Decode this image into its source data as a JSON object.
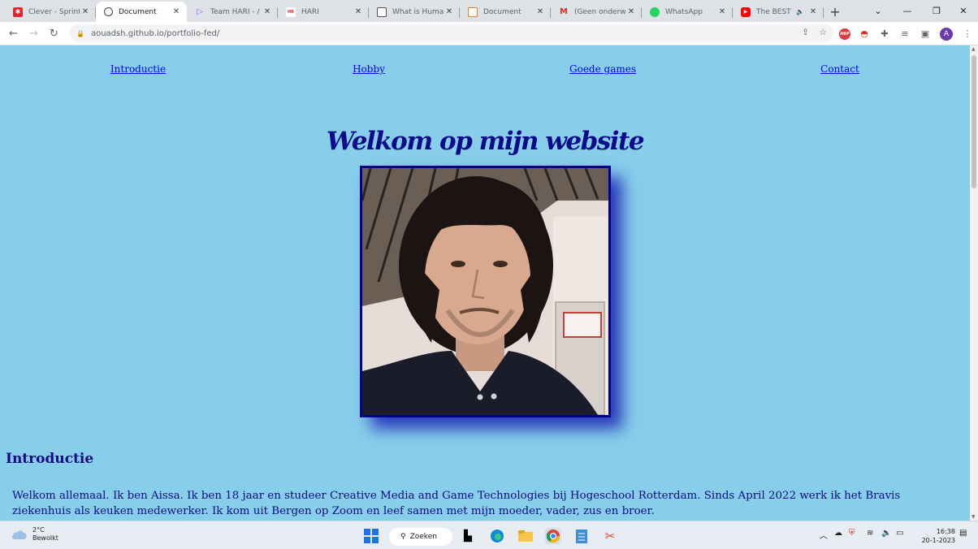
{
  "browser": {
    "tabs": [
      {
        "title": "Clever - Sprint",
        "favicon": "#e0282f"
      },
      {
        "title": "Document",
        "favicon": "#444444",
        "active": true
      },
      {
        "title": "Team HARI - /",
        "favicon": "#a05cf0"
      },
      {
        "title": "HARI",
        "favicon": "#e0282f"
      },
      {
        "title": "What is Huma",
        "favicon": "#555555"
      },
      {
        "title": "Document",
        "favicon": "#f07c1a"
      },
      {
        "title": "(Geen onderw",
        "favicon": "#d93025"
      },
      {
        "title": "WhatsApp",
        "favicon": "#25d366"
      },
      {
        "title": "The BEST",
        "favicon": "#ff0000"
      }
    ],
    "url": "aouadsh.github.io/portfolio-fed/",
    "profile_initial": "A"
  },
  "page": {
    "nav": [
      "Introductie",
      "Hobby",
      "Goede games",
      "Contact"
    ],
    "title": "Welkom op mijn website",
    "intro_heading": "Introductie",
    "intro_text": "Welkom allemaal. Ik ben Aissa. Ik ben 18 jaar en studeer Creative Media and Game Technologies bij Hogeschool Rotterdam. Sinds April 2022 werk ik het Bravis ziekenhuis als keuken medewerker. Ik kom uit Bergen op Zoom en leef samen met mijn moeder, vader, zus en broer."
  },
  "taskbar": {
    "temperature": "2°C",
    "weather": "Bewolkt",
    "search_label": "Zoeken",
    "time": "16:38",
    "date": "20-1-2023"
  },
  "colors": {
    "page_background": "#87ceeb",
    "heading": "#0a0a8a",
    "link": "#0000ee",
    "photo_border": "#00008b"
  }
}
